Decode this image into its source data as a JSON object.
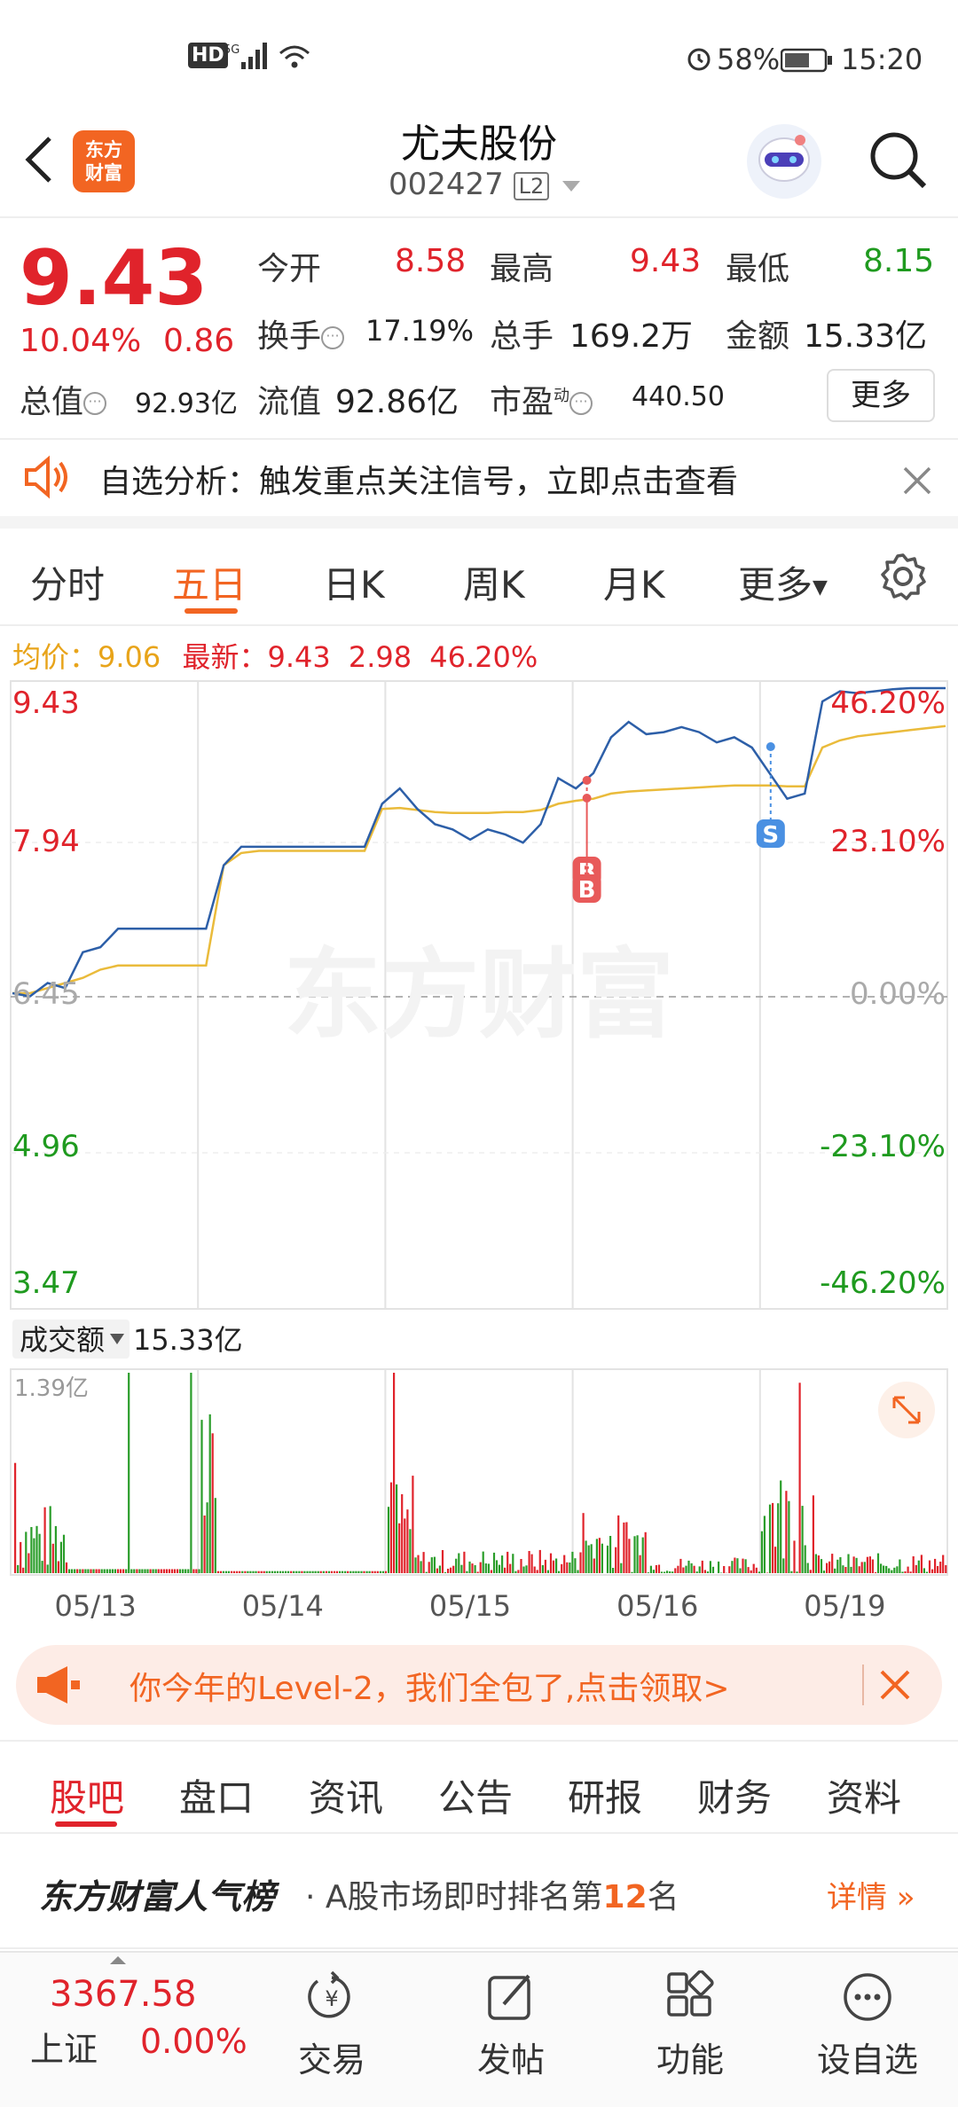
{
  "status_bar": {
    "network": "HD 5G",
    "battery": "58%",
    "time": "15:20"
  },
  "header": {
    "logo_text_top": "东方",
    "logo_text_bottom": "财富",
    "stock_name": "尤夫股份",
    "stock_code": "002427",
    "level_badge": "L2"
  },
  "quote": {
    "price": "9.43",
    "change_pct": "10.04%",
    "change_amt": "0.86",
    "open_label": "今开",
    "open_value": "8.58",
    "high_label": "最高",
    "high_value": "9.43",
    "low_label": "最低",
    "low_value": "8.15",
    "turnover_label": "换手",
    "turnover_value": "17.19%",
    "volume_label": "总手",
    "volume_value": "169.2万",
    "amount_label": "金额",
    "amount_value": "15.33亿",
    "mktcap_label": "总值",
    "mktcap_value": "92.93亿",
    "float_label": "流值",
    "float_value": "92.86亿",
    "pe_label": "市盈",
    "pe_superscript": "动",
    "pe_value": "440.50",
    "more_button": "更多"
  },
  "notice": {
    "text": "自选分析：触发重点关注信号，立即点击查看"
  },
  "chart_tabs": [
    "分时",
    "五日",
    "日K",
    "周K",
    "月K",
    "更多"
  ],
  "chart_active_tab": "五日",
  "avg_line": {
    "avg_label": "均价：",
    "avg_value": "9.06",
    "latest_label": "最新：",
    "latest_value": "9.43",
    "latest_change": "2.98",
    "latest_pct": "46.20%"
  },
  "chart_data": {
    "type": "line",
    "y_left_ticks": [
      "9.43",
      "7.94",
      "6.45",
      "4.96",
      "3.47"
    ],
    "y_right_ticks": [
      "46.20%",
      "23.10%",
      "0.00%",
      "-23.10%",
      "-46.20%"
    ],
    "x_labels": [
      "05/13",
      "05/14",
      "05/15",
      "05/16",
      "05/19"
    ],
    "ylim": [
      3.47,
      9.43
    ],
    "watermark": "东方财富",
    "series": [
      {
        "values": [
          6.45,
          6.42,
          6.55,
          6.5,
          6.85,
          6.9,
          7.08,
          7.08,
          7.08,
          7.08,
          7.08,
          7.08,
          7.7,
          7.88,
          7.88,
          7.88,
          7.88,
          7.88,
          7.88,
          7.88,
          7.88,
          8.3,
          8.45,
          8.25,
          8.1,
          8.05,
          7.95,
          8.05,
          8.0,
          7.92,
          8.1,
          8.55,
          8.45,
          8.6,
          8.95,
          9.1,
          8.98,
          9.0,
          9.05,
          9.0,
          8.9,
          8.95,
          8.85,
          8.6,
          8.35,
          8.4,
          9.3,
          9.4,
          9.38,
          9.4,
          9.42,
          9.43,
          9.43,
          9.43
        ]
      },
      {
        "values": [
          6.45,
          6.45,
          6.5,
          6.55,
          6.6,
          6.68,
          6.72,
          6.72,
          6.72,
          6.72,
          6.72,
          6.72,
          7.7,
          7.82,
          7.84,
          7.84,
          7.84,
          7.84,
          7.84,
          7.84,
          7.84,
          8.25,
          8.26,
          8.24,
          8.22,
          8.21,
          8.21,
          8.21,
          8.22,
          8.22,
          8.24,
          8.3,
          8.33,
          8.35,
          8.4,
          8.42,
          8.43,
          8.44,
          8.45,
          8.46,
          8.47,
          8.48,
          8.48,
          8.48,
          8.47,
          8.47,
          8.85,
          8.92,
          8.96,
          8.98,
          9.0,
          9.02,
          9.04,
          9.06
        ]
      }
    ],
    "markers": [
      {
        "label": "B",
        "day": "05/15"
      },
      {
        "label": "B",
        "day": "05/15"
      },
      {
        "label": "S",
        "day": "05/16"
      }
    ]
  },
  "volume_chart": {
    "selector_label": "成交额",
    "total": "15.33亿",
    "max_label": "1.39亿"
  },
  "promo": {
    "text": "你今年的Level-2，我们全包了,点击领取>"
  },
  "news_tabs": [
    "股吧",
    "盘口",
    "资讯",
    "公告",
    "研报",
    "财务",
    "资料"
  ],
  "news_active_tab": "股吧",
  "ranking": {
    "brand": "东方财富人气榜",
    "text_prefix": "· A股市场即时排名第",
    "rank": "12",
    "text_suffix": "名",
    "detail": "详情"
  },
  "bottom_nav": {
    "index_value": "3367.58",
    "index_name": "上证",
    "index_change": "0.00%",
    "items": [
      "交易",
      "发帖",
      "功能",
      "设自选"
    ]
  }
}
